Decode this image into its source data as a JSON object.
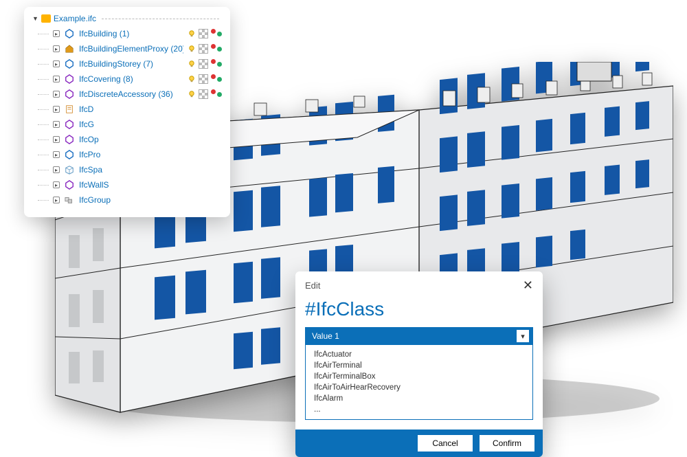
{
  "tree": {
    "root_label": "Example.ifc",
    "items": [
      {
        "label": "IfcBuilding (1)",
        "icon": "hex-blue",
        "badges": true
      },
      {
        "label": "IfcBuildingElementProxy (20)",
        "icon": "house",
        "badges": true
      },
      {
        "label": "IfcBuildingStorey (7)",
        "icon": "hex-blue",
        "badges": true
      },
      {
        "label": "IfcCovering (8)",
        "icon": "hex-purple",
        "badges": true
      },
      {
        "label": "IfcDiscreteAccessory (36)",
        "icon": "hex-purple",
        "badges": true
      },
      {
        "label": "IfcD",
        "icon": "doc",
        "badges": false
      },
      {
        "label": "IfcG",
        "icon": "hex-purple",
        "badges": false
      },
      {
        "label": "IfcOp",
        "icon": "hex-purple",
        "badges": false
      },
      {
        "label": "IfcPro",
        "icon": "hex-blue",
        "badges": false
      },
      {
        "label": "IfcSpa",
        "icon": "cube",
        "badges": false
      },
      {
        "label": "IfcWallS",
        "icon": "hex-purple",
        "badges": false
      },
      {
        "label": "IfcGroup",
        "icon": "group",
        "badges": false
      }
    ]
  },
  "dialog": {
    "header": "Edit",
    "title": "#IfcClass",
    "selected": "Value 1",
    "options": [
      "IfcActuator",
      "IfcAirTerminal",
      "IfcAirTerminalBox",
      "IfcAirToAirHearRecovery",
      "IfcAlarm",
      "..."
    ],
    "cancel": "Cancel",
    "confirm": "Confirm"
  },
  "colors": {
    "accent": "#0b6fb8"
  }
}
